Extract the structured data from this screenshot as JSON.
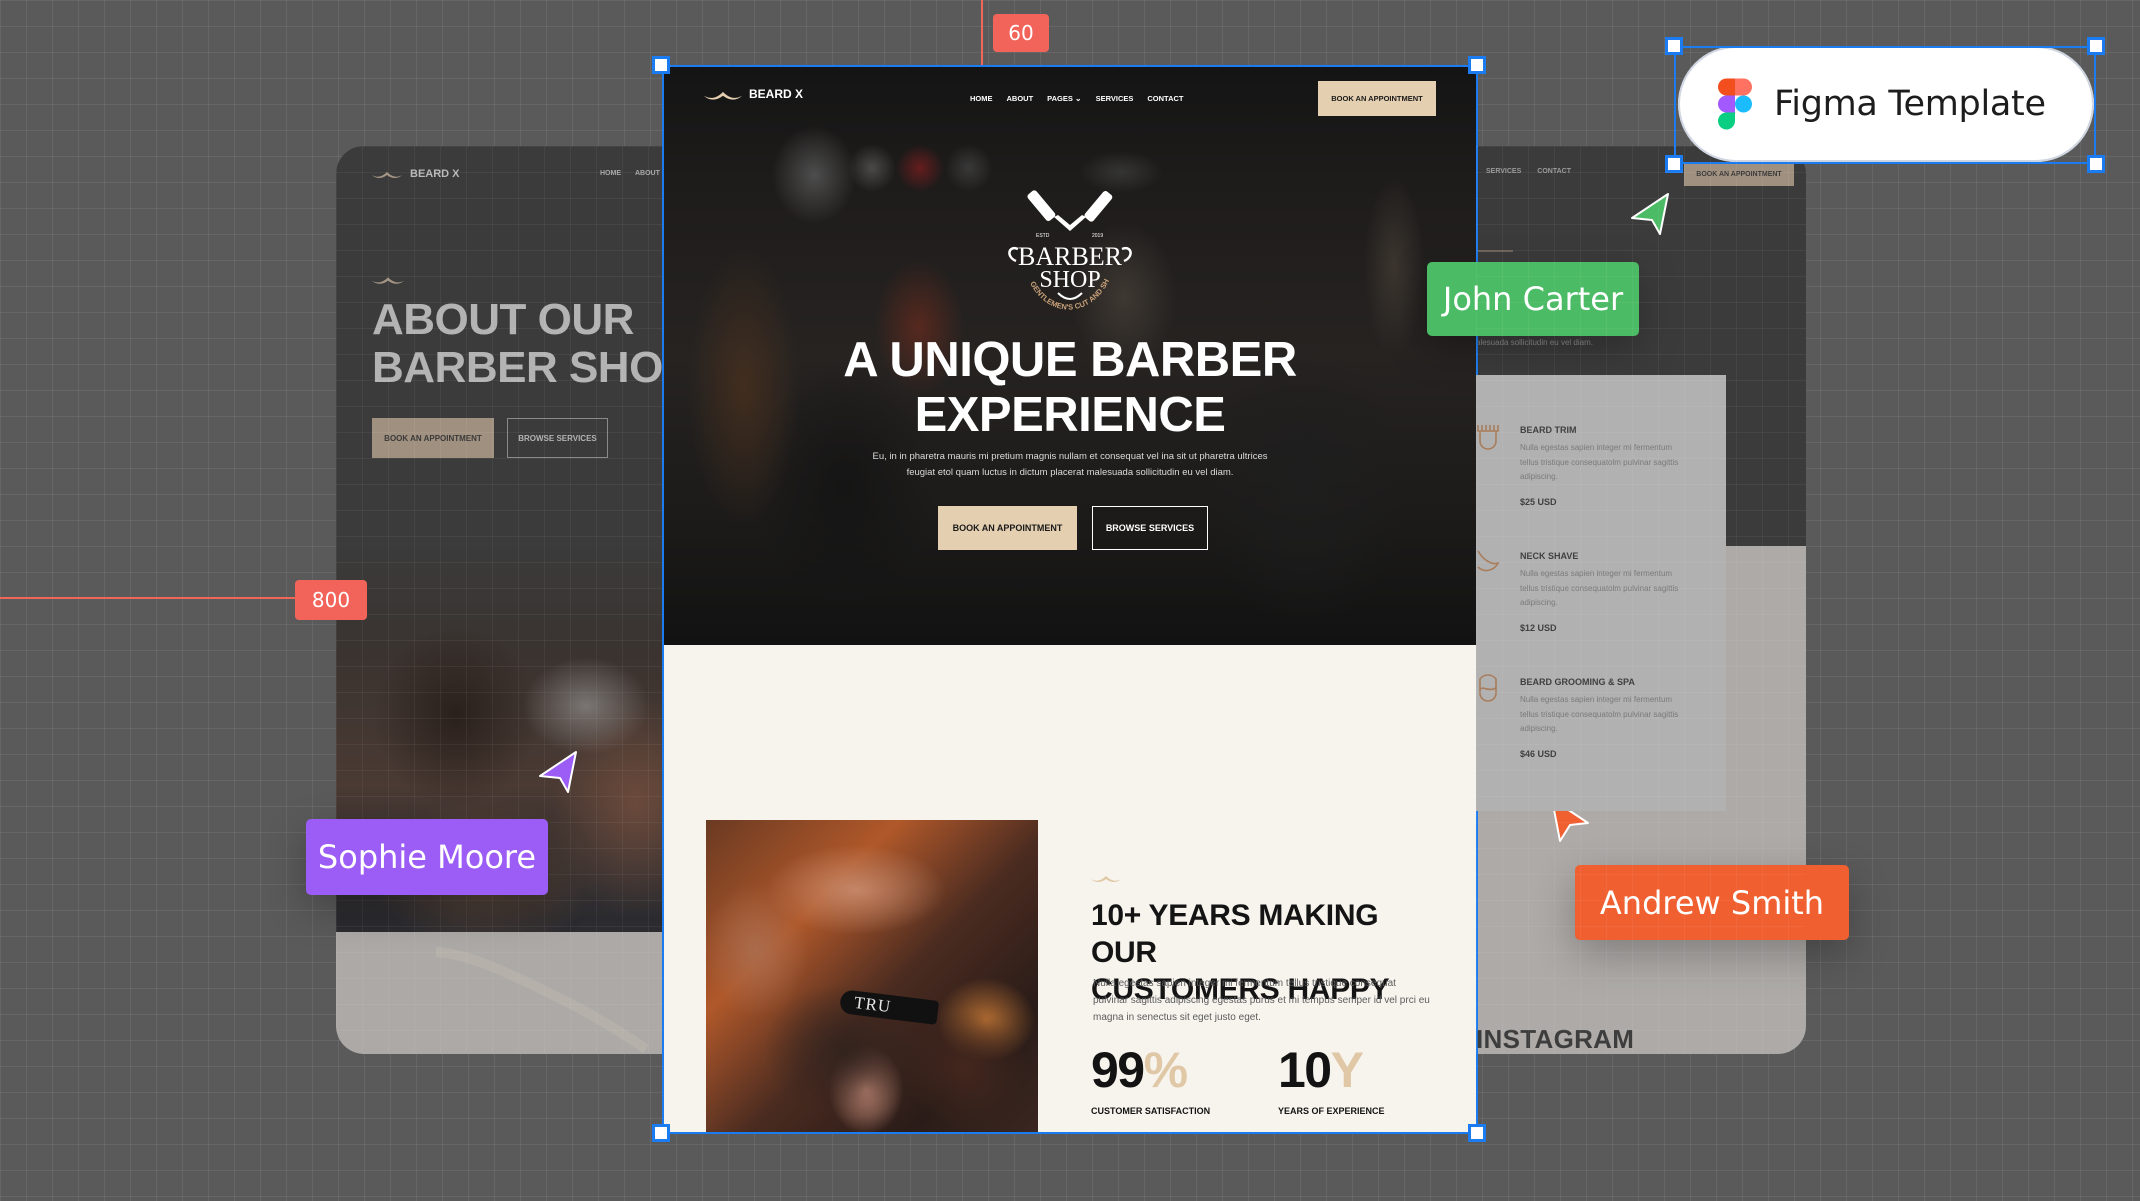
{
  "canvas": {
    "guides": {
      "vertical_label": "60",
      "horizontal_label": "800"
    },
    "figma_badge": {
      "label": "Figma Template",
      "icon": "figma-logo-icon"
    },
    "collaborators": [
      {
        "name": "John Carter",
        "color": "#4cbb65"
      },
      {
        "name": "Sophie Moore",
        "color": "#9b5df5"
      },
      {
        "name": "Andrew Smith",
        "color": "#f05f30"
      }
    ]
  },
  "main_page": {
    "nav": {
      "brand": "BEARD X",
      "items": [
        "HOME",
        "ABOUT",
        "PAGES",
        "SERVICES",
        "CONTACT"
      ],
      "pages_chevron": "⌄",
      "cta": "BOOK AN APPOINTMENT"
    },
    "hero": {
      "badge": {
        "top_left": "ESTD",
        "top_right": "2019",
        "line1": "BARBER",
        "line2": "SHOP",
        "arc": "GENTLEMEN'S CUT AND SHAVE"
      },
      "title_line1": "A UNIQUE BARBER",
      "title_line2": "EXPERIENCE",
      "description_line1": "Eu, in in pharetra mauris mi pretium magnis nullam et consequat vel ina sit ut pharetra ultrices",
      "description_line2": "feugiat etol quam luctus in dictum placerat malesuada sollicitudin eu vel diam.",
      "primary_button": "BOOK AN APPOINTMENT",
      "secondary_button": "BROWSE SERVICES"
    },
    "about": {
      "image_text": "TRU",
      "title_line1": "10+ YEARS MAKING OUR",
      "title_line2": "CUSTOMERS HAPPY",
      "description": "Nulla egestas sapien integer mi fermentum tellus tristique consequat pulvinar sagittis adipiscing egestas purus et mi tempus semper id vel prci eu magna in senectus sit eget justo eget.",
      "stats": [
        {
          "value": "99",
          "accent": "%",
          "label": "CUSTOMER SATISFACTION"
        },
        {
          "value": "10",
          "accent": "Y",
          "label": "YEARS OF EXPERIENCE"
        }
      ]
    }
  },
  "left_page": {
    "brand": "BEARD X",
    "nav_items": [
      "HOME",
      "ABOUT"
    ],
    "title_line1": "ABOUT OUR",
    "title_line2": "BARBER SHOP",
    "primary_button": "BOOK AN APPOINTMENT",
    "secondary_button": "BROWSE SERVICES"
  },
  "right_page": {
    "nav_items": [
      "SERVICES",
      "CONTACT"
    ],
    "cta": "BOOK AN APPOINTMENT",
    "desc_tail": "alesuada sollicitudin eu vel diam.",
    "services": [
      {
        "title": "BEARD TRIM",
        "description": "Nulla egestas sapien integer mi fermentum tellus tristique consequatolm pulvinar sagittis adipiscing.",
        "price": "$25 USD",
        "icon": "trimmer-icon"
      },
      {
        "title": "NECK SHAVE",
        "description": "Nulla egestas sapien integer mi fermentum tellus tristique consequatolm pulvinar sagittis adipiscing.",
        "price": "$12 USD",
        "icon": "razor-icon"
      },
      {
        "title": "BEARD GROOMING & SPA",
        "description": "Nulla egestas sapien integer mi fermentum tellus tristique consequatolm pulvinar sagittis adipiscing.",
        "price": "$46 USD",
        "icon": "face-icon"
      }
    ],
    "instagram_heading": "INSTAGRAM"
  }
}
